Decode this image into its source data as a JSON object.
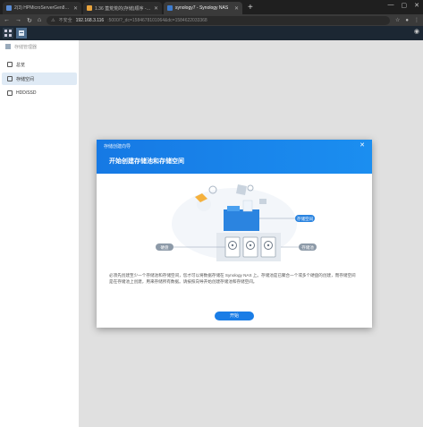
{
  "browser": {
    "tabs": [
      {
        "label": "2(3) HPMicroServerGen8E3(...",
        "icon_color": "#5a8dd6",
        "active": false
      },
      {
        "label": "1.36 蓋荒荒的(存储)顺序 - HPMi...",
        "icon_color": "#e8a33c",
        "active": false
      },
      {
        "label": "synology7 - Synology NAS",
        "icon_color": "#3d7ccf",
        "active": true
      }
    ],
    "url_security": "不安全",
    "url_host": "192.168.3.116",
    "url_rest": ":5000/?_dc=1584678101064&dc=1584622033368"
  },
  "app": {
    "header_title": "存储管理器",
    "sidebar": [
      {
        "label": "总览",
        "icon": "overview-icon"
      },
      {
        "label": "存储空间",
        "icon": "storage-icon"
      },
      {
        "label": "HDD/SSD",
        "icon": "disk-icon"
      }
    ]
  },
  "modal": {
    "small_title": "存储创建向导",
    "title": "开始创建存储池和存储空间",
    "labels": {
      "volume": "存储空间",
      "pool": "存储池",
      "disk": "硬盘"
    },
    "description": "必须先创建至少一个存储池和存储空间，您才可以将数据存储在 Synology NAS 上。存储池是已聚合一个或多个硬盘的创建，而存储空间是在存储池上创建，用来存储所有数据。请按照向导开始创建存储池和存储空间。",
    "button_label": "开始"
  },
  "colors": {
    "accent": "#1a7de6",
    "dsm_bar": "#1c2733"
  }
}
